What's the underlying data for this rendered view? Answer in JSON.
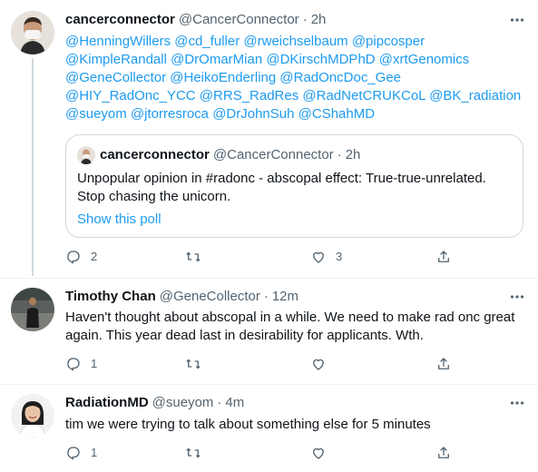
{
  "tweets": [
    {
      "name": "cancerconnector",
      "handle": "@CancerConnector",
      "time": "2h",
      "avatar": "person-with-mask-avatar",
      "mentions": [
        "@HenningWillers",
        "@cd_fuller",
        "@rweichselbaum",
        "@pipcosper",
        "@KimpleRandall",
        "@DrOmarMian",
        "@DKirschMDPhD",
        "@xrtGenomics",
        "@GeneCollector",
        "@HeikoEnderling",
        "@RadOncDoc_Gee",
        "@HIY_RadOnc_YCC",
        "@RRS_RadRes",
        "@RadNetCRUKCoL",
        "@BK_radiation",
        "@sueyom",
        "@jtorresroca",
        "@DrJohnSuh",
        "@CShahMD"
      ],
      "quote": {
        "name": "cancerconnector",
        "handle": "@CancerConnector",
        "time": "2h",
        "text": "Unpopular opinion in #radonc - abscopal effect: True-true-unrelated. Stop chasing the unicorn.",
        "link": "Show this poll"
      },
      "replies": "2",
      "retweets": "",
      "likes": "3"
    },
    {
      "name": "Timothy Chan",
      "handle": "@GeneCollector",
      "time": "12m",
      "avatar": "man-standing-avatar",
      "text": "Haven't thought about abscopal in a while.  We need to make rad onc  great again.  This year dead last in desirability for applicants. Wth.",
      "replies": "1",
      "retweets": "",
      "likes": ""
    },
    {
      "name": "RadiationMD",
      "handle": "@sueyom",
      "time": "4m",
      "avatar": "woman-smiling-avatar",
      "text": "tim we were trying to talk about something else for 5 minutes",
      "replies": "1",
      "retweets": "",
      "likes": ""
    }
  ],
  "separator": "·",
  "colors": {
    "accent": "#1d9bf0",
    "muted": "#536471",
    "text": "#0f1419",
    "border": "#cfd9de"
  }
}
